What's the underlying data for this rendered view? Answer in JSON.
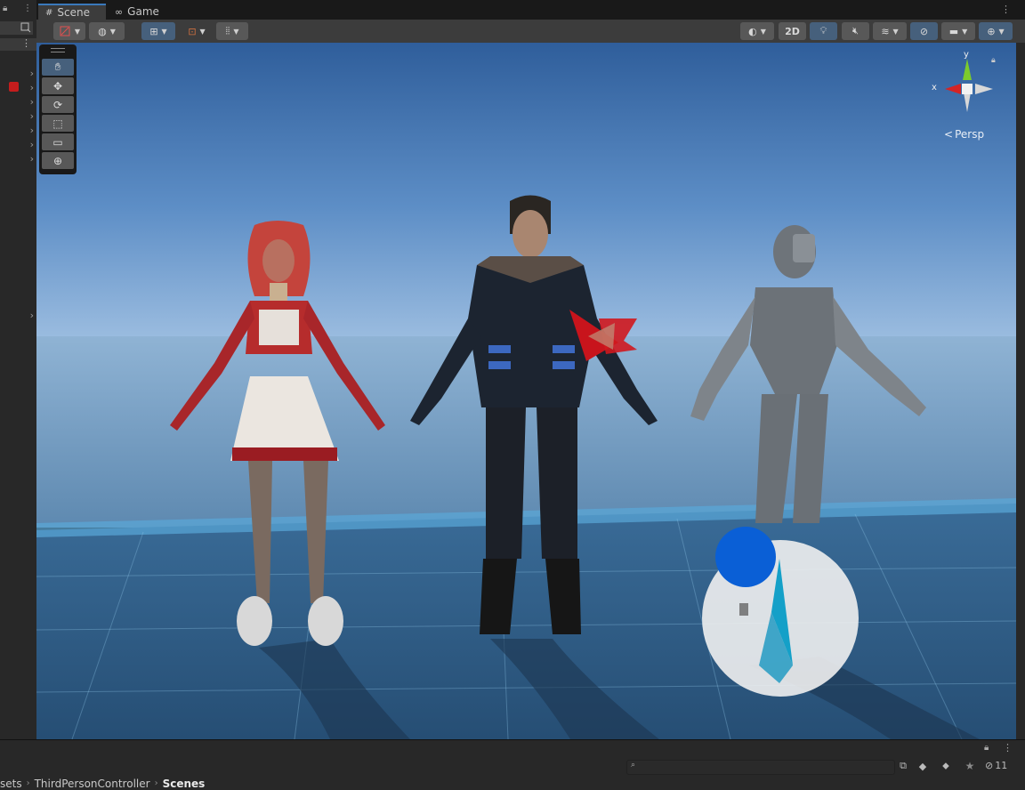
{
  "tabs": [
    {
      "label": "Scene",
      "icon": "grid-icon"
    },
    {
      "label": "Game",
      "icon": "gamepad-icon"
    }
  ],
  "toolbar": {
    "toggle_2d_label": "2D"
  },
  "gizmo": {
    "axis_x": "x",
    "axis_y": "y",
    "projection_label": "Persp"
  },
  "tools": [
    {
      "name": "hand-tool",
      "icon": "hand-icon"
    },
    {
      "name": "move-tool",
      "icon": "move-icon"
    },
    {
      "name": "rotate-tool",
      "icon": "rotate-icon"
    },
    {
      "name": "scale-tool",
      "icon": "scale-icon"
    },
    {
      "name": "rect-tool",
      "icon": "rect-icon"
    },
    {
      "name": "transform-tool",
      "icon": "transform-icon"
    }
  ],
  "project": {
    "breadcrumb": [
      "sets",
      "ThirdPersonController",
      "Scenes"
    ],
    "hidden_count": "11",
    "search_placeholder": ""
  },
  "colors": {
    "accent": "#3a79bb",
    "sky_top": "#2f5e9b",
    "horizon": "#9cbde0",
    "floor": "#2d5a82"
  }
}
